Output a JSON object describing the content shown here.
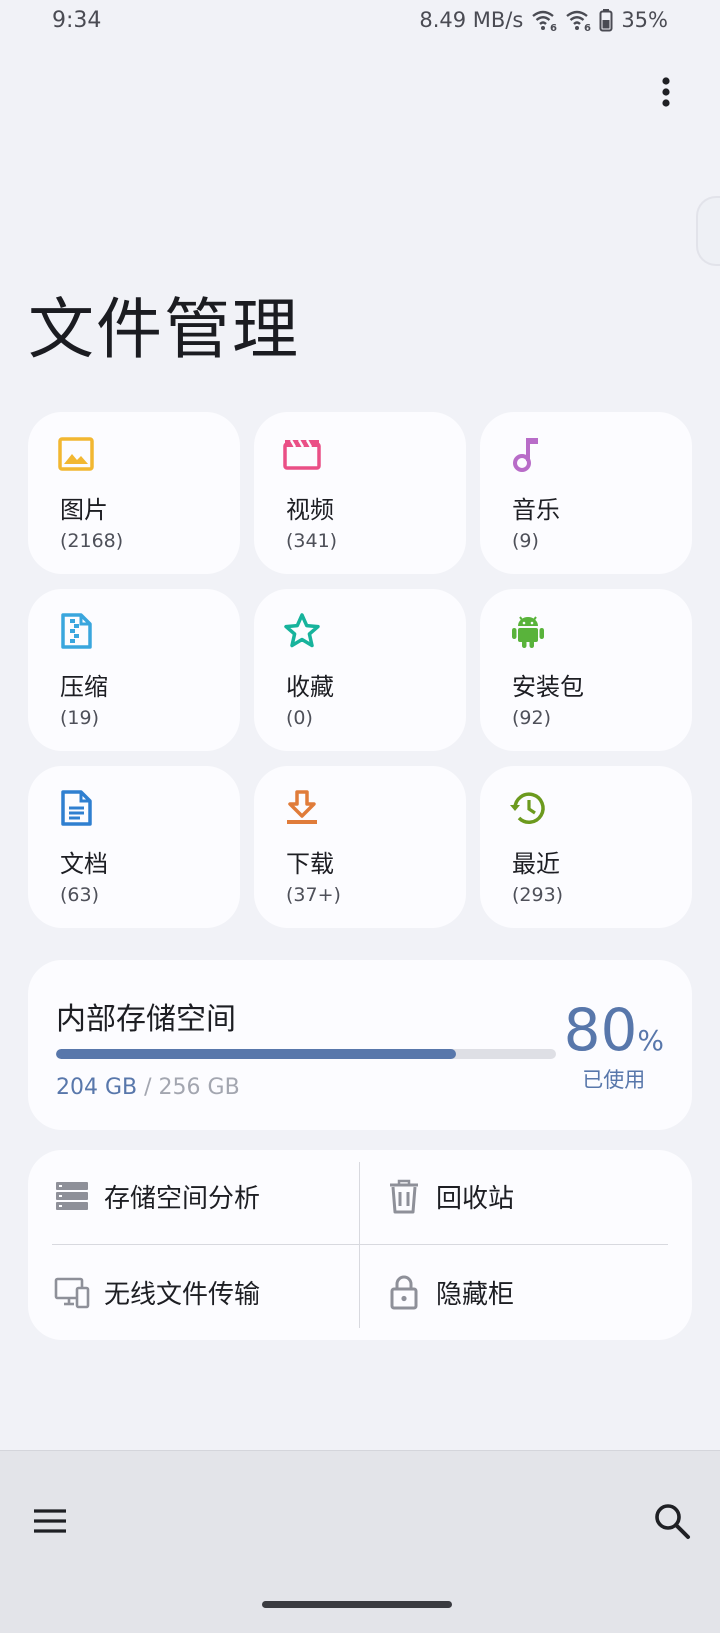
{
  "status_bar": {
    "time": "9:34",
    "network_speed": "8.49 MB/s",
    "battery": "35%",
    "icons": [
      "wifi6-icon",
      "wifi6-icon",
      "battery-icon"
    ]
  },
  "header": {
    "title": "文件管理",
    "more_icon": "more-vert-icon"
  },
  "categories": [
    {
      "label": "图片",
      "count": "(2168)",
      "icon": "image-icon",
      "color": "#f2b731"
    },
    {
      "label": "视频",
      "count": "(341)",
      "icon": "video-icon",
      "color": "#ea4f86"
    },
    {
      "label": "音乐",
      "count": "(9)",
      "icon": "music-icon",
      "color": "#b86cc8"
    },
    {
      "label": "压缩",
      "count": "(19)",
      "icon": "archive-icon",
      "color": "#3aa6dd"
    },
    {
      "label": "收藏",
      "count": "(0)",
      "icon": "star-icon",
      "color": "#17b39c"
    },
    {
      "label": "安装包",
      "count": "(92)",
      "icon": "android-icon",
      "color": "#59b33b"
    },
    {
      "label": "文档",
      "count": "(63)",
      "icon": "document-icon",
      "color": "#2f7fd0"
    },
    {
      "label": "下载",
      "count": "(37+)",
      "icon": "download-icon",
      "color": "#e07c3a"
    },
    {
      "label": "最近",
      "count": "(293)",
      "icon": "history-icon",
      "color": "#6c9a1e"
    }
  ],
  "storage": {
    "title": "内部存储空间",
    "used": "204 GB",
    "separator": "/",
    "total": "256 GB",
    "percent_value": "80",
    "percent_sign": "%",
    "percent_caption": "已使用",
    "used_fraction": 0.8,
    "accent_color": "#5877ab"
  },
  "tools": [
    {
      "label": "存储空间分析",
      "icon": "storage-analysis-icon"
    },
    {
      "label": "回收站",
      "icon": "trash-icon"
    },
    {
      "label": "无线文件传输",
      "icon": "wireless-transfer-icon"
    },
    {
      "label": "隐藏柜",
      "icon": "lock-icon"
    }
  ],
  "bottom_bar": {
    "menu_icon": "hamburger-menu-icon",
    "search_icon": "search-icon"
  }
}
